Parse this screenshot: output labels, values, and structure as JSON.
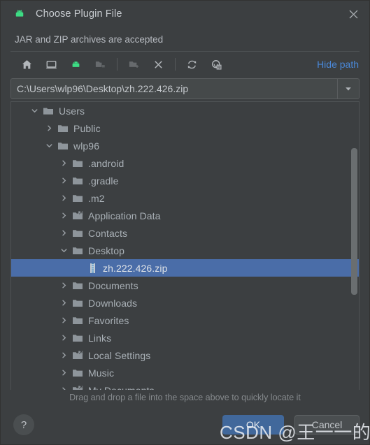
{
  "window": {
    "title": "Choose Plugin File",
    "icon": "android-icon",
    "close_label": "✕",
    "subtitle": "JAR and ZIP archives are accepted"
  },
  "toolbar": {
    "items": [
      {
        "name": "home-icon",
        "tooltip": "Home",
        "disabled": false
      },
      {
        "name": "desktop-icon",
        "tooltip": "Desktop",
        "disabled": false
      },
      {
        "name": "android-icon",
        "tooltip": "Android SDK",
        "disabled": false
      },
      {
        "name": "folder-icon",
        "tooltip": "Project",
        "disabled": true
      },
      {
        "name": "new-folder-icon",
        "tooltip": "New Folder",
        "disabled": true
      },
      {
        "name": "delete-icon",
        "tooltip": "Delete",
        "disabled": false
      },
      {
        "name": "refresh-icon",
        "tooltip": "Refresh",
        "disabled": false
      },
      {
        "name": "show-hidden-icon",
        "tooltip": "Show Hidden Files",
        "disabled": false
      }
    ],
    "hide_path_label": "Hide path"
  },
  "path_field": {
    "value": "C:\\Users\\wlp96\\Desktop\\zh.222.426.zip",
    "placeholder": "",
    "dropdown_icon": "chevron-down-icon"
  },
  "tree": {
    "rows": [
      {
        "label": "Users",
        "indent": 2,
        "twisty": "down",
        "icon": "folder-open-icon",
        "selected": false
      },
      {
        "label": "Public",
        "indent": 3,
        "twisty": "right",
        "icon": "folder-icon",
        "selected": false
      },
      {
        "label": "wlp96",
        "indent": 3,
        "twisty": "down",
        "icon": "folder-icon",
        "selected": false
      },
      {
        "label": ".android",
        "indent": 4,
        "twisty": "right",
        "icon": "folder-icon",
        "selected": false
      },
      {
        "label": ".gradle",
        "indent": 4,
        "twisty": "right",
        "icon": "folder-icon",
        "selected": false
      },
      {
        "label": ".m2",
        "indent": 4,
        "twisty": "right",
        "icon": "folder-icon",
        "selected": false
      },
      {
        "label": "Application Data",
        "indent": 4,
        "twisty": "right",
        "icon": "folder-link-icon",
        "selected": false
      },
      {
        "label": "Contacts",
        "indent": 4,
        "twisty": "right",
        "icon": "folder-icon",
        "selected": false
      },
      {
        "label": "Desktop",
        "indent": 4,
        "twisty": "down",
        "icon": "folder-icon",
        "selected": false
      },
      {
        "label": "zh.222.426.zip",
        "indent": 5,
        "twisty": "none",
        "icon": "zip-file-icon",
        "selected": true
      },
      {
        "label": "Documents",
        "indent": 4,
        "twisty": "right",
        "icon": "folder-icon",
        "selected": false
      },
      {
        "label": "Downloads",
        "indent": 4,
        "twisty": "right",
        "icon": "folder-icon",
        "selected": false
      },
      {
        "label": "Favorites",
        "indent": 4,
        "twisty": "right",
        "icon": "folder-icon",
        "selected": false
      },
      {
        "label": "Links",
        "indent": 4,
        "twisty": "right",
        "icon": "folder-icon",
        "selected": false
      },
      {
        "label": "Local Settings",
        "indent": 4,
        "twisty": "right",
        "icon": "folder-link-icon",
        "selected": false
      },
      {
        "label": "Music",
        "indent": 4,
        "twisty": "right",
        "icon": "folder-icon",
        "selected": false
      },
      {
        "label": "My Documents",
        "indent": 4,
        "twisty": "right",
        "icon": "folder-link-icon",
        "selected": false
      }
    ],
    "scrollbar": {
      "thumb_top_pct": 16,
      "thumb_height_pct": 51
    }
  },
  "hint": "Drag and drop a file into the space above to quickly locate it",
  "footer": {
    "help_label": "?",
    "ok_label": "OK",
    "cancel_label": "Cancel"
  },
  "watermark": "CSDN @王一一的博客",
  "colors": {
    "dialog_bg": "#3c3f41",
    "selection_blue": "#4a6da8",
    "link_blue": "#4a88d8",
    "android_green": "#3ddc84",
    "ok_button": "#41689b",
    "text": "#a9b0b6"
  }
}
